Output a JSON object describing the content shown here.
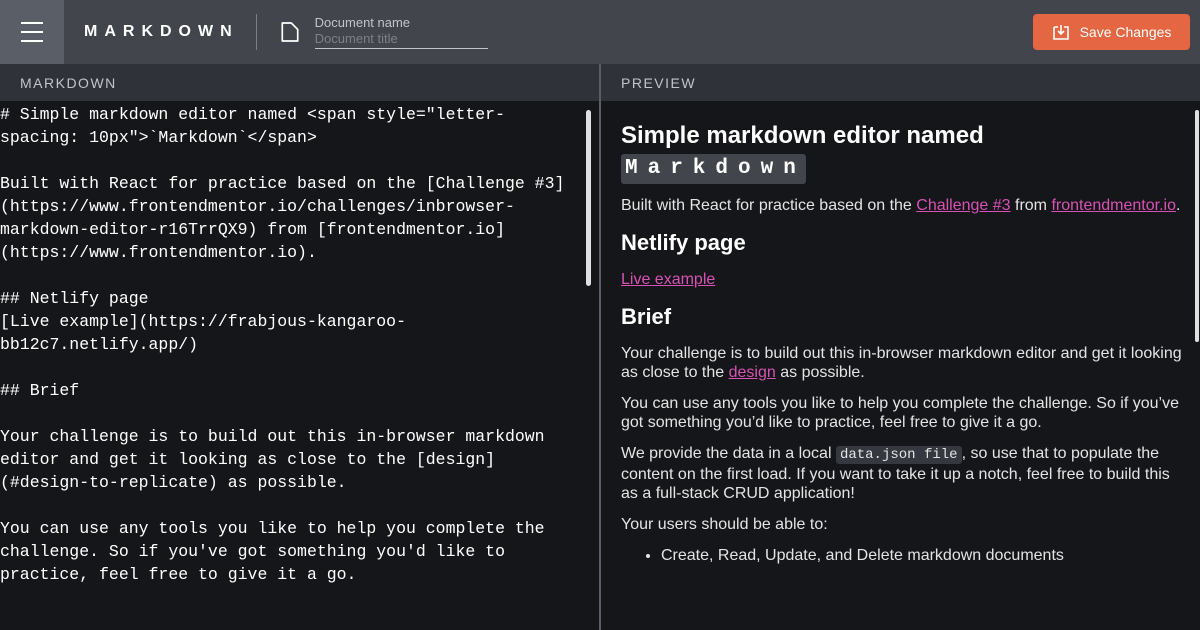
{
  "header": {
    "brand": "MARKDOWN",
    "doc_label": "Document name",
    "doc_placeholder": "Document title",
    "save_label": "Save Changes"
  },
  "panes": {
    "markdown_title": "MARKDOWN",
    "preview_title": "PREVIEW"
  },
  "editor": {
    "lines": [
      "# Simple markdown editor named <span style=\"letter-spacing: 10px\">`Markdown`</span>",
      "",
      "Built with React for practice based on the [Challenge #3](https://www.frontendmentor.io/challenges/inbrowser-markdown-editor-r16TrrQX9) from [frontendmentor.io](https://www.frontendmentor.io).",
      "",
      "## Netlify page",
      "[Live example](https://frabjous-kangaroo-bb12c7.netlify.app/)",
      "",
      "## Brief",
      "",
      "Your challenge is to build out this in-browser markdown editor and get it looking as close to the [design](#design-to-replicate) as possible.",
      "",
      "You can use any tools you like to help you complete the challenge. So if you've got something you'd like to practice, feel free to give it a go."
    ]
  },
  "preview": {
    "h1": "Simple markdown editor named",
    "h1_code": "Markdown",
    "p1_a": "Built with React for practice based on the ",
    "p1_link1": "Challenge #3",
    "p1_b": " from ",
    "p1_link2": "frontendmentor.io",
    "p1_c": ".",
    "h2_netlify": "Netlify page",
    "live_link": "Live example",
    "h2_brief": "Brief",
    "p2_a": "Your challenge is to build out this in-browser markdown editor and get it looking as close to the ",
    "p2_link": "design",
    "p2_b": " as possible.",
    "p3": "You can use any tools you like to help you complete the challenge. So if you’ve got something you’d like to practice, feel free to give it a go.",
    "p4_a": "We provide the data in a local ",
    "p4_code": "data.json file",
    "p4_b": ", so use that to populate the content on the first load. If you want to take it up a notch, feel free to build this as a full-stack CRUD application!",
    "p5": "Your users should be able to:",
    "li1": "Create, Read, Update, and Delete markdown documents"
  }
}
